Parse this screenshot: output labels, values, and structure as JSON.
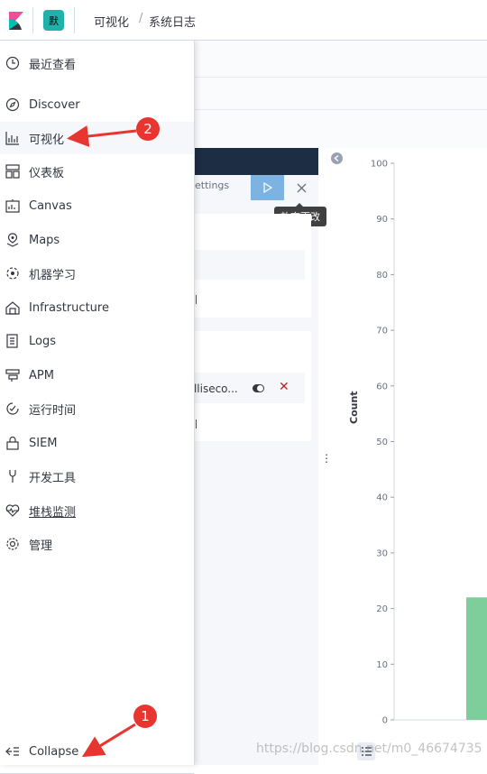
{
  "topbar": {
    "space_initial": "默",
    "breadcrumbs": [
      "可视化",
      "系统日志"
    ],
    "breadcrumb_separator": "/"
  },
  "sidenav": {
    "recent": {
      "label": "最近查看",
      "icon": "clock-icon"
    },
    "items": [
      {
        "label": "Discover",
        "icon": "compass-icon"
      },
      {
        "label": "可视化",
        "icon": "visualize-icon"
      },
      {
        "label": "仪表板",
        "icon": "dashboard-icon"
      },
      {
        "label": "Canvas",
        "icon": "canvas-icon"
      },
      {
        "label": "Maps",
        "icon": "maps-icon"
      },
      {
        "label": "机器学习",
        "icon": "machine-learning-icon"
      },
      {
        "label": "Infrastructure",
        "icon": "infrastructure-icon"
      },
      {
        "label": "Logs",
        "icon": "logs-icon"
      },
      {
        "label": "APM",
        "icon": "apm-icon"
      },
      {
        "label": "运行时间",
        "icon": "uptime-icon"
      },
      {
        "label": "SIEM",
        "icon": "siem-icon"
      },
      {
        "label": "开发工具",
        "icon": "dev-tools-icon"
      },
      {
        "label": "堆栈监测",
        "icon": "monitoring-icon"
      },
      {
        "label": "管理",
        "icon": "gear-icon"
      }
    ],
    "collapse_label": "Collapse"
  },
  "editor": {
    "settings_tab": "ettings",
    "discard_tooltip": "放弃更改",
    "aggregation_label": "nilliseco..."
  },
  "chart_data": {
    "type": "bar",
    "ylabel": "Count",
    "ylim": [
      0,
      100
    ],
    "yticks": [
      "100",
      "90",
      "80",
      "70",
      "60",
      "50",
      "40",
      "30",
      "20",
      "10",
      "0"
    ],
    "values": [
      22
    ],
    "colors": {
      "bar": "#7ece9b"
    }
  },
  "annotations": {
    "badge1": "1",
    "badge2": "2",
    "color": "#e8352f"
  },
  "watermark": "https://blog.csdn.net/m0_46674735"
}
